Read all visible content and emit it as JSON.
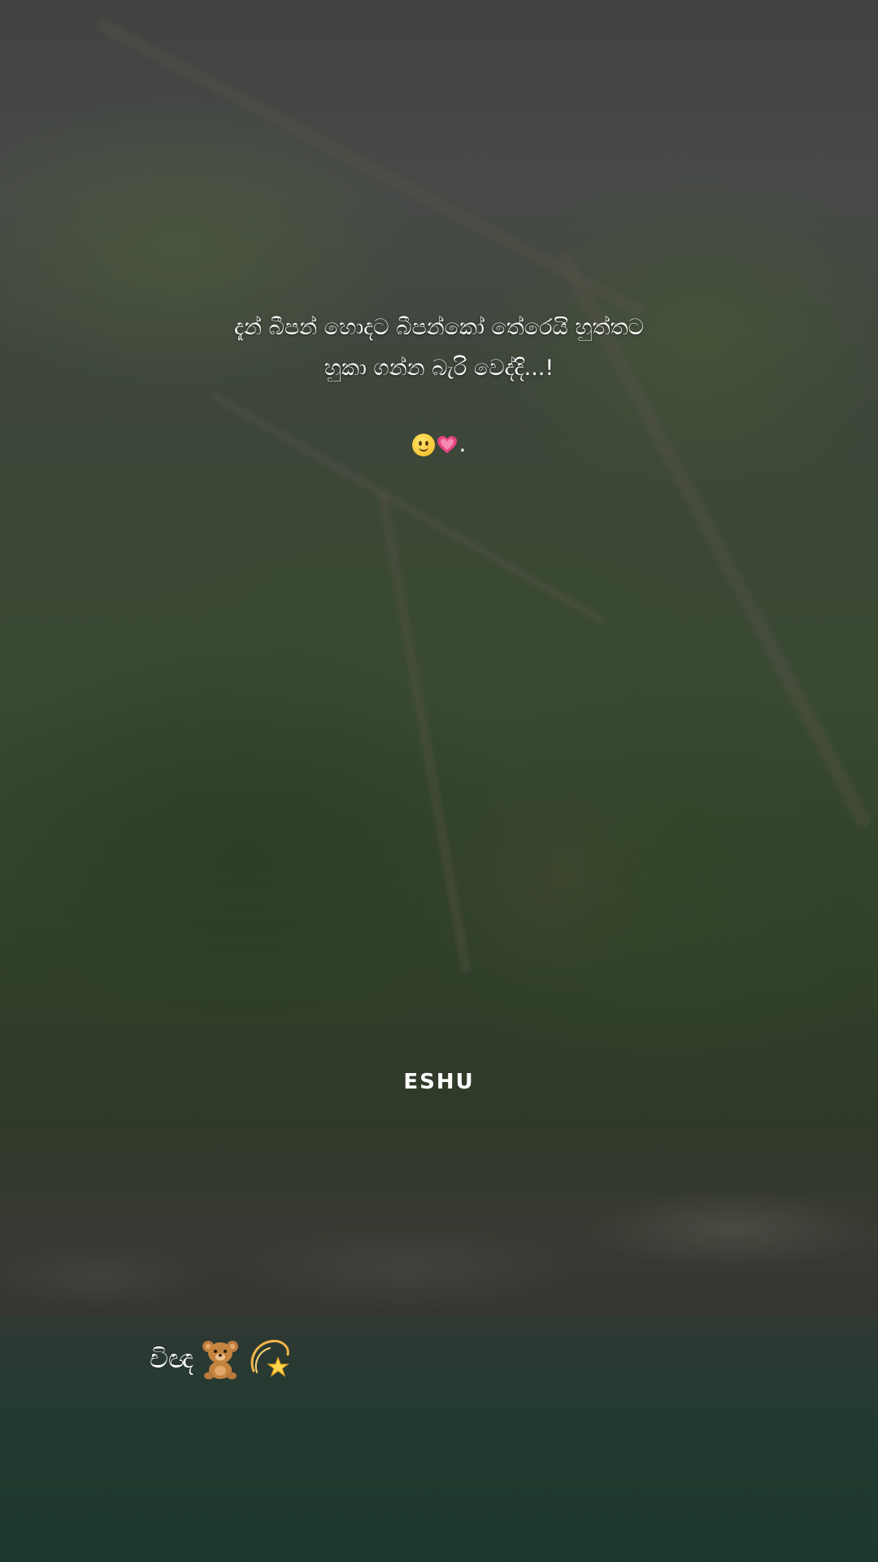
{
  "caption": {
    "line1": "දැන් බීපන් හොදට බීපන්කෝ තේරෙයි හුත්තට",
    "line2": "හුකා ගන්න බැරි වෙද්දි...!",
    "trailing_dot": "."
  },
  "emojis": {
    "caption_emojis": [
      "smiling-face-icon",
      "pink-heart-icon"
    ],
    "corner_emojis": [
      "teddy-bear-icon",
      "dizzy-star-icon"
    ]
  },
  "signature": "ESHU",
  "corner_text": "චිඥ"
}
